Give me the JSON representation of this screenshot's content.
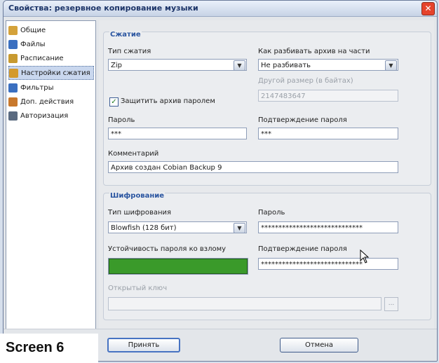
{
  "window": {
    "title": "Свойства: резервное копирование музыки",
    "close_glyph": "✕"
  },
  "sidebar": {
    "items": [
      {
        "label": "Общие",
        "icon": "general-icon",
        "color": "#d4a23a"
      },
      {
        "label": "Файлы",
        "icon": "files-icon",
        "color": "#3a6fc0"
      },
      {
        "label": "Расписание",
        "icon": "schedule-icon",
        "color": "#c89a30"
      },
      {
        "label": "Настройки сжатия",
        "icon": "compression-icon",
        "color": "#d49a2c",
        "selected": true
      },
      {
        "label": "Фильтры",
        "icon": "filters-icon",
        "color": "#3a6fc0"
      },
      {
        "label": "Доп. действия",
        "icon": "actions-icon",
        "color": "#c8782c"
      },
      {
        "label": "Авторизация",
        "icon": "auth-icon",
        "color": "#5a6a80"
      }
    ]
  },
  "compression": {
    "group_title": "Сжатие",
    "type_label": "Тип сжатия",
    "type_value": "Zip",
    "split_label": "Как разбивать архив на части",
    "split_value": "Не разбивать",
    "other_size_label": "Другой размер (в байтах)",
    "other_size_value": "2147483647",
    "protect_label": "Защитить архив паролем",
    "protect_checked": true,
    "password_label": "Пароль",
    "password_value": "***",
    "confirm_label": "Подтверждение пароля",
    "confirm_value": "***",
    "comment_label": "Комментарий",
    "comment_value": "Архив создан Cobian Backup 9"
  },
  "encryption": {
    "group_title": "Шифрование",
    "type_label": "Тип шифрования",
    "type_value": "Blowfish (128 бит)",
    "password_label": "Пароль",
    "password_value": "*****************************",
    "strength_label": "Устойчивость пароля ко взлому",
    "strength_fraction": 1.0,
    "strength_color": "#3a9a2a",
    "confirm_label": "Подтверждение пароля",
    "confirm_value": "*****************************",
    "public_key_label": "Открытый ключ",
    "public_key_value": "",
    "browse_label": "..."
  },
  "buttons": {
    "apply": "Принять",
    "cancel": "Отмена"
  },
  "overlay": {
    "caption": "Screen 6"
  }
}
